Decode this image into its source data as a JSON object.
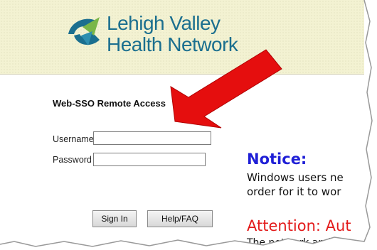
{
  "brand": {
    "name_line1": "Lehigh Valley",
    "name_line2": "Health Network"
  },
  "login": {
    "section_title": "Web-SSO Remote Access",
    "username_label": "Username",
    "password_label": "Password",
    "username_value": "",
    "password_value": "",
    "signin_label": "Sign In",
    "help_label": "Help/FAQ"
  },
  "notice": {
    "title": "Notice:",
    "line1": "Windows users ne",
    "line2": "order for it to wor"
  },
  "attention": {
    "title": "Attention: Aut",
    "line1": "The network and"
  },
  "colors": {
    "brand_teal": "#1b6f8f",
    "brand_green": "#7ab648",
    "notice_blue": "#1f1fd6",
    "attention_red": "#e31b1b",
    "arrow_red": "#e50e0e"
  }
}
